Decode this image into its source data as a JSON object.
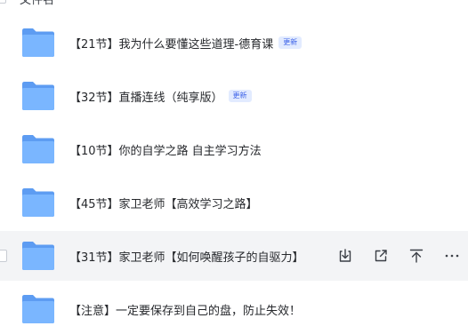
{
  "header": {
    "label": "文件名"
  },
  "files": [
    {
      "name": "【21节】我为什么要懂这些道理-德育课",
      "badge": "更新"
    },
    {
      "name": "【32节】直播连线（纯享版）",
      "badge": "更新"
    },
    {
      "name": "【10节】你的自学之路 自主学习方法",
      "badge": ""
    },
    {
      "name": "【45节】家卫老师【高效学习之路】",
      "badge": ""
    },
    {
      "name": "【31节】家卫老师【如何唤醒孩子的自驱力】",
      "badge": ""
    },
    {
      "name": "【注意】一定要保存到自己的盘，防止失效！",
      "badge": ""
    }
  ],
  "hovered_index": 4,
  "row_actions": [
    "download-icon",
    "share-icon",
    "move-to-top-icon",
    "more-icon"
  ],
  "colors": {
    "folder_front": "#7ab6ff",
    "folder_back": "#5d9cf2",
    "badge_bg": "#e2ebff",
    "badge_text": "#3d63e8",
    "hover_bg": "#f3f4f6"
  }
}
